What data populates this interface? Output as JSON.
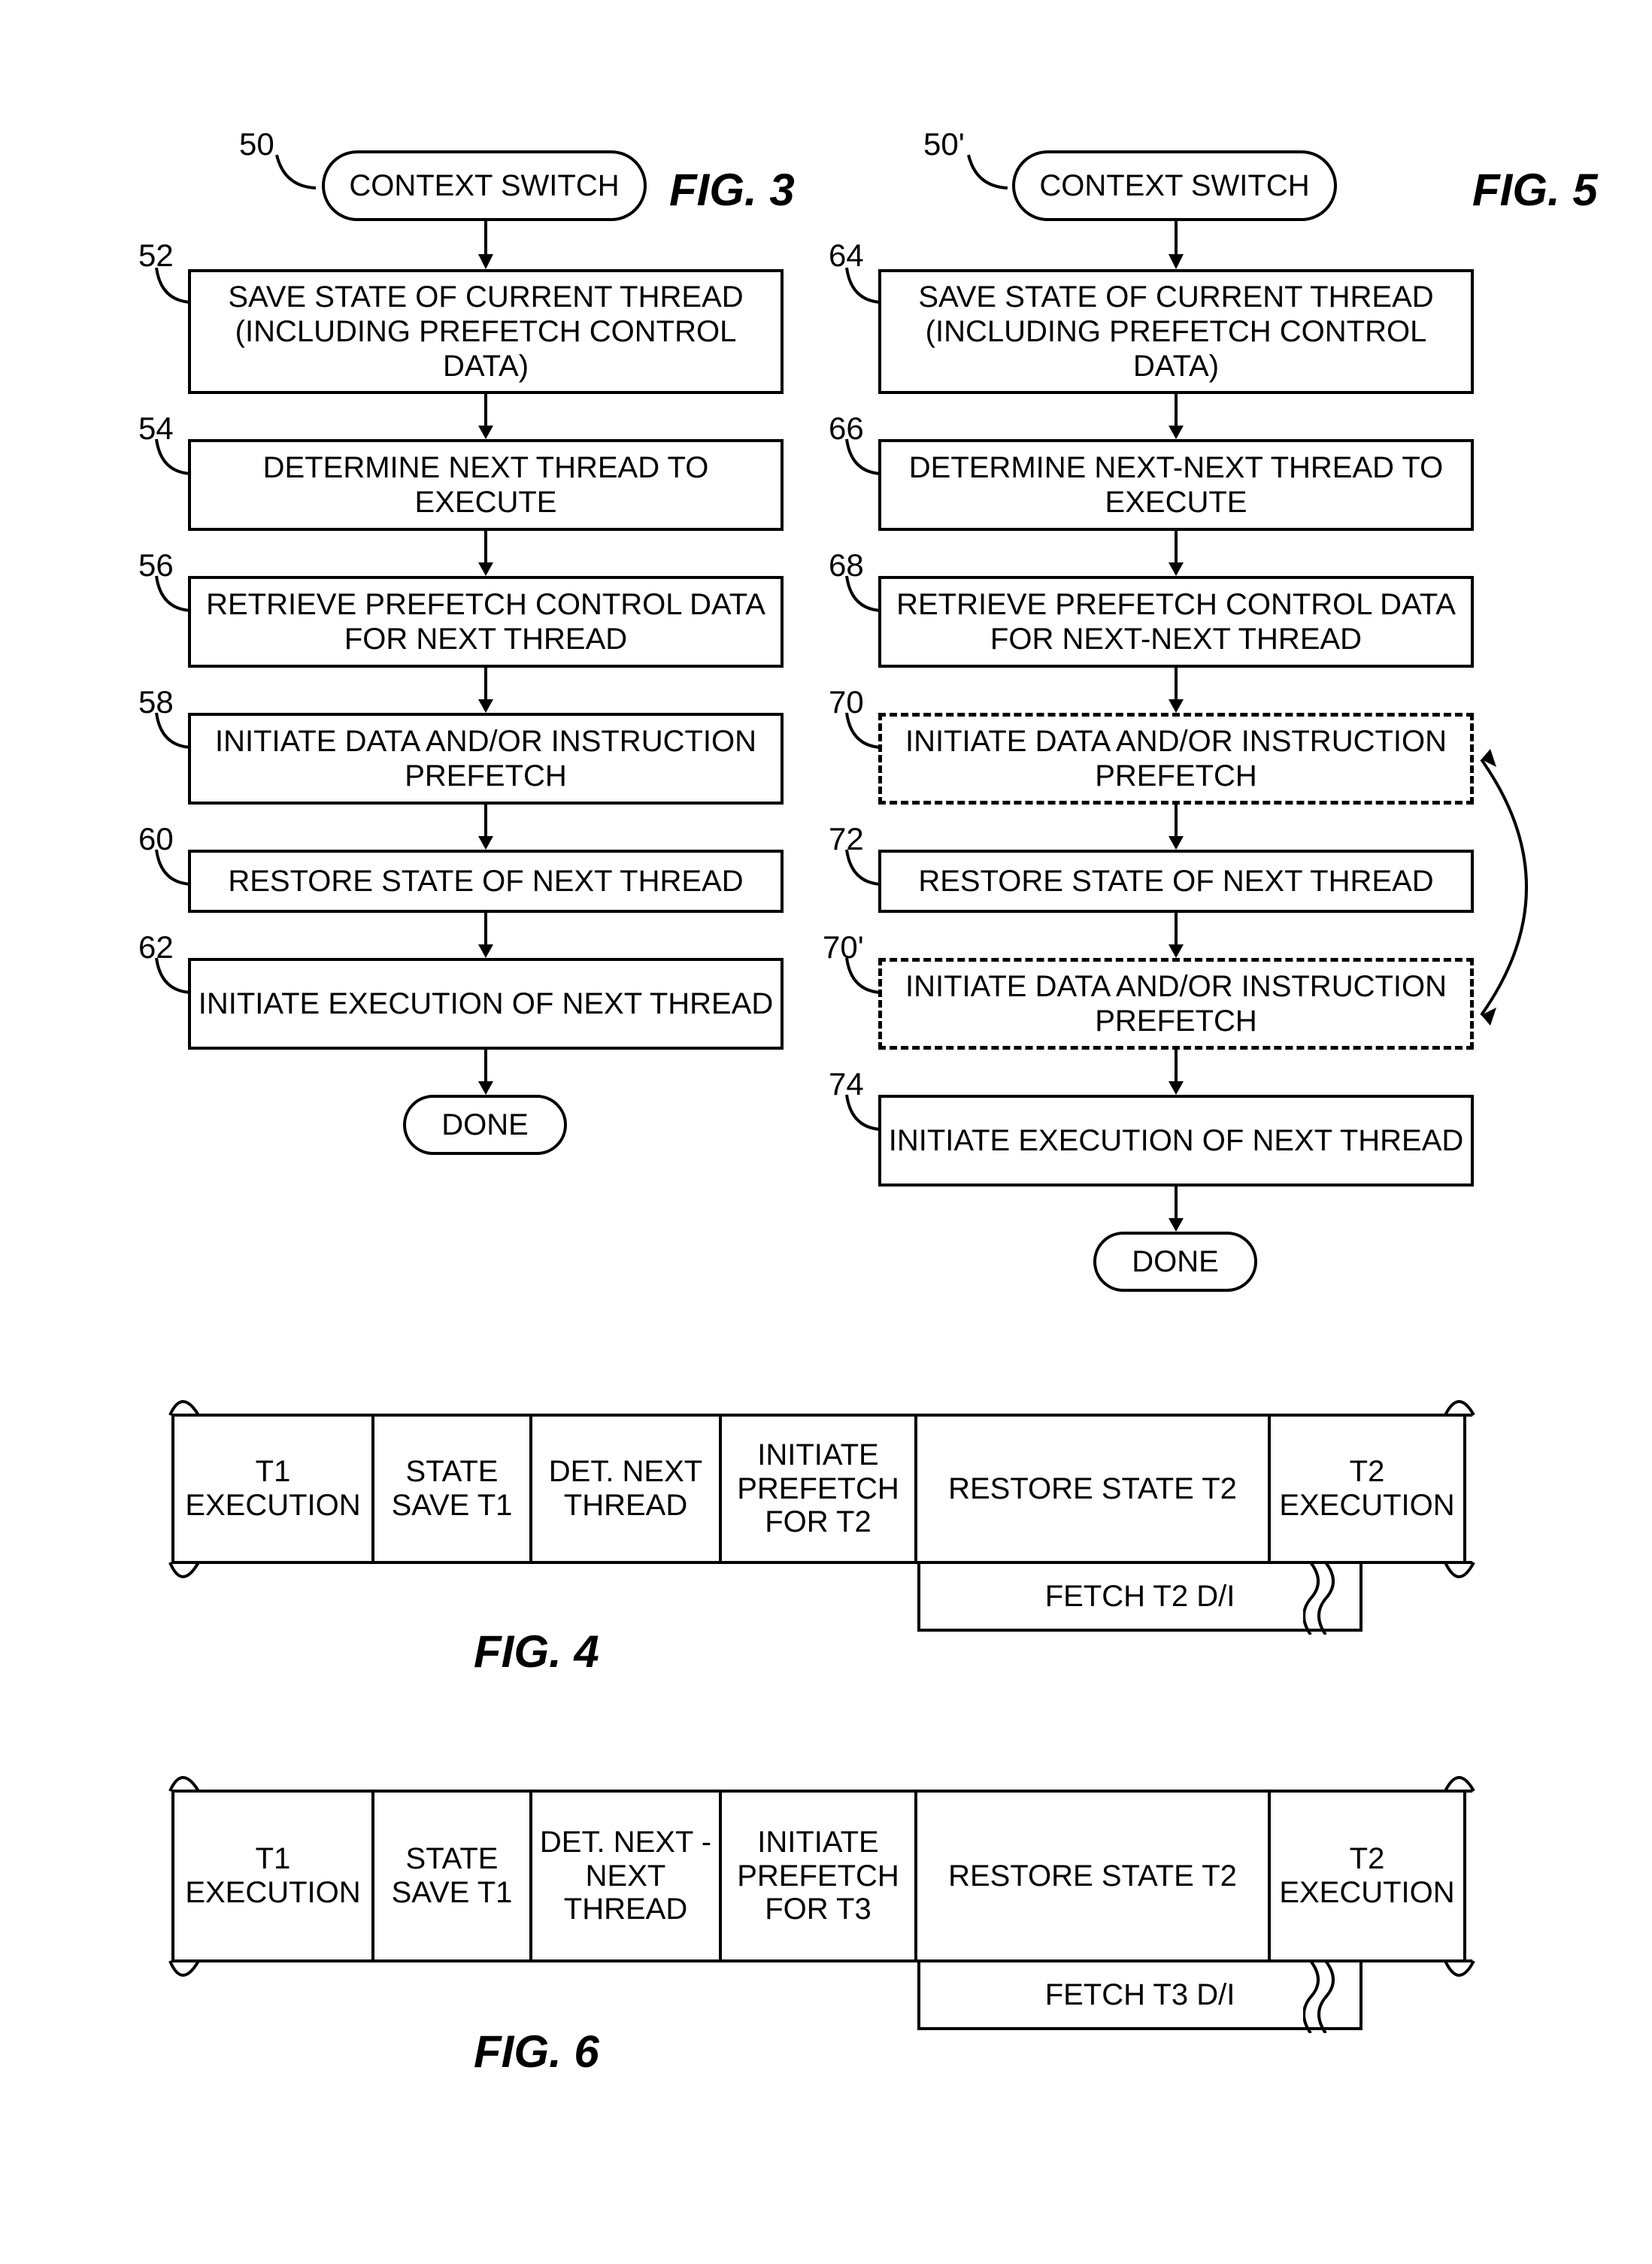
{
  "fig3": {
    "label": "FIG. 3",
    "refs": {
      "start": "50",
      "b1": "52",
      "b2": "54",
      "b3": "56",
      "b4": "58",
      "b5": "60",
      "b6": "62"
    },
    "start": "CONTEXT SWITCH",
    "b1": "SAVE STATE OF CURRENT THREAD (INCLUDING PREFETCH CONTROL DATA)",
    "b2": "DETERMINE NEXT THREAD TO EXECUTE",
    "b3": "RETRIEVE PREFETCH CONTROL DATA FOR NEXT THREAD",
    "b4": "INITIATE DATA AND/OR INSTRUCTION PREFETCH",
    "b5": "RESTORE STATE OF NEXT THREAD",
    "b6": "INITIATE EXECUTION OF NEXT THREAD",
    "done": "DONE"
  },
  "fig5": {
    "label": "FIG. 5",
    "refs": {
      "start": "50'",
      "b1": "64",
      "b2": "66",
      "b3": "68",
      "b4": "70",
      "b5": "72",
      "b4b": "70'",
      "b6": "74"
    },
    "start": "CONTEXT SWITCH",
    "b1": "SAVE STATE OF CURRENT THREAD (INCLUDING PREFETCH CONTROL DATA)",
    "b2": "DETERMINE NEXT-NEXT THREAD TO EXECUTE",
    "b3": "RETRIEVE PREFETCH CONTROL DATA FOR NEXT-NEXT THREAD",
    "b4": "INITIATE DATA AND/OR INSTRUCTION PREFETCH",
    "b5": "RESTORE STATE OF NEXT THREAD",
    "b4b": "INITIATE DATA AND/OR INSTRUCTION PREFETCH",
    "b6": "INITIATE EXECUTION OF NEXT THREAD",
    "done": "DONE"
  },
  "fig4": {
    "label": "FIG. 4",
    "cells": [
      "T1 EXECUTION",
      "STATE SAVE T1",
      "DET. NEXT THREAD",
      "INITIATE PREFETCH FOR T2",
      "RESTORE STATE T2",
      "T2 EXECUTION"
    ],
    "fetch": "FETCH T2 D/I"
  },
  "fig6": {
    "label": "FIG. 6",
    "cells": [
      "T1 EXECUTION",
      "STATE SAVE T1",
      "DET. NEXT -NEXT THREAD",
      "INITIATE PREFETCH FOR T3",
      "RESTORE STATE T2",
      "T2 EXECUTION"
    ],
    "fetch": "FETCH T3 D/I"
  },
  "chart_data": [
    {
      "type": "flowchart",
      "id": "FIG.3",
      "title": "Context switch with prefetch for next thread",
      "nodes": [
        {
          "id": "50",
          "shape": "terminator",
          "text": "CONTEXT SWITCH"
        },
        {
          "id": "52",
          "shape": "process",
          "text": "SAVE STATE OF CURRENT THREAD (INCLUDING PREFETCH CONTROL DATA)"
        },
        {
          "id": "54",
          "shape": "process",
          "text": "DETERMINE NEXT THREAD TO EXECUTE"
        },
        {
          "id": "56",
          "shape": "process",
          "text": "RETRIEVE PREFETCH CONTROL DATA FOR NEXT THREAD"
        },
        {
          "id": "58",
          "shape": "process",
          "text": "INITIATE DATA AND/OR INSTRUCTION PREFETCH"
        },
        {
          "id": "60",
          "shape": "process",
          "text": "RESTORE STATE OF NEXT THREAD"
        },
        {
          "id": "62",
          "shape": "process",
          "text": "INITIATE EXECUTION OF NEXT THREAD"
        },
        {
          "id": "D3",
          "shape": "terminator",
          "text": "DONE"
        }
      ],
      "edges": [
        [
          "50",
          "52"
        ],
        [
          "52",
          "54"
        ],
        [
          "54",
          "56"
        ],
        [
          "56",
          "58"
        ],
        [
          "58",
          "60"
        ],
        [
          "60",
          "62"
        ],
        [
          "62",
          "D3"
        ]
      ]
    },
    {
      "type": "flowchart",
      "id": "FIG.5",
      "title": "Context switch with prefetch for next-next thread (alternate prefetch placement)",
      "nodes": [
        {
          "id": "50'",
          "shape": "terminator",
          "text": "CONTEXT SWITCH"
        },
        {
          "id": "64",
          "shape": "process",
          "text": "SAVE STATE OF CURRENT THREAD (INCLUDING PREFETCH CONTROL DATA)"
        },
        {
          "id": "66",
          "shape": "process",
          "text": "DETERMINE NEXT-NEXT THREAD TO EXECUTE"
        },
        {
          "id": "68",
          "shape": "process",
          "text": "RETRIEVE PREFETCH CONTROL DATA FOR NEXT-NEXT THREAD"
        },
        {
          "id": "70",
          "shape": "process",
          "text": "INITIATE DATA AND/OR INSTRUCTION PREFETCH",
          "style": "dashed"
        },
        {
          "id": "72",
          "shape": "process",
          "text": "RESTORE STATE OF NEXT THREAD"
        },
        {
          "id": "70'",
          "shape": "process",
          "text": "INITIATE DATA AND/OR INSTRUCTION PREFETCH",
          "style": "dashed"
        },
        {
          "id": "74",
          "shape": "process",
          "text": "INITIATE EXECUTION OF NEXT THREAD"
        },
        {
          "id": "D5",
          "shape": "terminator",
          "text": "DONE"
        }
      ],
      "edges": [
        [
          "50'",
          "64"
        ],
        [
          "64",
          "66"
        ],
        [
          "66",
          "68"
        ],
        [
          "68",
          "70"
        ],
        [
          "70",
          "72"
        ],
        [
          "72",
          "70'"
        ],
        [
          "70'",
          "74"
        ],
        [
          "74",
          "D5"
        ],
        [
          "70",
          "70'",
          {
            "kind": "alt-placement",
            "bidirectional": true
          }
        ]
      ]
    },
    {
      "type": "timeline",
      "id": "FIG.4",
      "row": [
        "T1 EXECUTION",
        "STATE SAVE T1",
        "DET. NEXT THREAD",
        "INITIATE PREFETCH FOR T2",
        "RESTORE STATE T2",
        "T2 EXECUTION"
      ],
      "below": {
        "spanFrom": 4,
        "spanToBreak": 5,
        "text": "FETCH T2 D/I"
      }
    },
    {
      "type": "timeline",
      "id": "FIG.6",
      "row": [
        "T1 EXECUTION",
        "STATE SAVE T1",
        "DET. NEXT -NEXT THREAD",
        "INITIATE PREFETCH FOR T3",
        "RESTORE STATE T2",
        "T2 EXECUTION"
      ],
      "below": {
        "spanFrom": 4,
        "spanToBreak": 5,
        "text": "FETCH T3 D/I"
      }
    }
  ]
}
